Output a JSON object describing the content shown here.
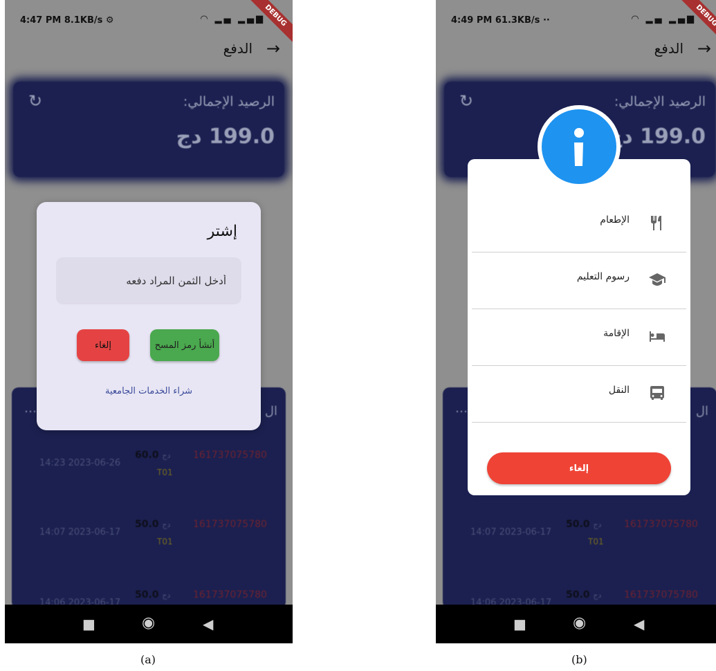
{
  "screens": [
    {
      "status": {
        "time": "4:47 PM",
        "speed": "8.1KB/s"
      },
      "appbar": {
        "title": "الدفع"
      },
      "balance": {
        "label": "الرصيد الإجمالي:",
        "amount": "199.0 دج"
      },
      "transactions_header": "ال",
      "transactions": [
        {
          "date": "14:23 2023-06-26",
          "amount": "60.0",
          "currency": "دج",
          "ref": "161737075780",
          "code": "T01"
        },
        {
          "date": "14:07 2023-06-17",
          "amount": "50.0",
          "currency": "دج",
          "ref": "161737075780",
          "code": "T01"
        },
        {
          "date": "14:06 2023-06-17",
          "amount": "50.0",
          "currency": "دج",
          "ref": "161737075780",
          "code": ""
        }
      ],
      "dialog": {
        "title": "إشتر",
        "price_placeholder": "أدخل الثمن المراد دفعه",
        "cancel_label": "إلغاء",
        "create_label": "أنشأ رمز المسح",
        "buy_services_link": "شراء الخدمات الجامعية"
      },
      "caption": "(a)"
    },
    {
      "status": {
        "time": "4:49 PM",
        "speed": "61.3KB/s"
      },
      "appbar": {
        "title": "الدفع"
      },
      "balance": {
        "label": "الرصيد الإجمالي:",
        "amount": "199.0 دج"
      },
      "transactions_header": "ال",
      "transactions": [
        {
          "date": "14:07 2023-06-17",
          "amount": "50.0",
          "currency": "دج",
          "ref": "161737075780",
          "code": "T01"
        },
        {
          "date": "14:06 2023-06-17",
          "amount": "50.0",
          "currency": "دج",
          "ref": "161737075780",
          "code": ""
        }
      ],
      "services": [
        {
          "label": "الإطعام",
          "icon": "restaurant-icon"
        },
        {
          "label": "رسوم التعليم",
          "icon": "graduation-cap-icon"
        },
        {
          "label": "الإقامة",
          "icon": "bed-icon"
        },
        {
          "label": "النقل",
          "icon": "bus-icon"
        }
      ],
      "dialog_cancel_label": "إلغاء",
      "caption": "(b)"
    }
  ],
  "debug_ribbon": "DEBUG",
  "colors": {
    "card": "#1b2050",
    "info": "#1e93f0",
    "cancel": "#e54343",
    "create": "#4aa84e"
  }
}
